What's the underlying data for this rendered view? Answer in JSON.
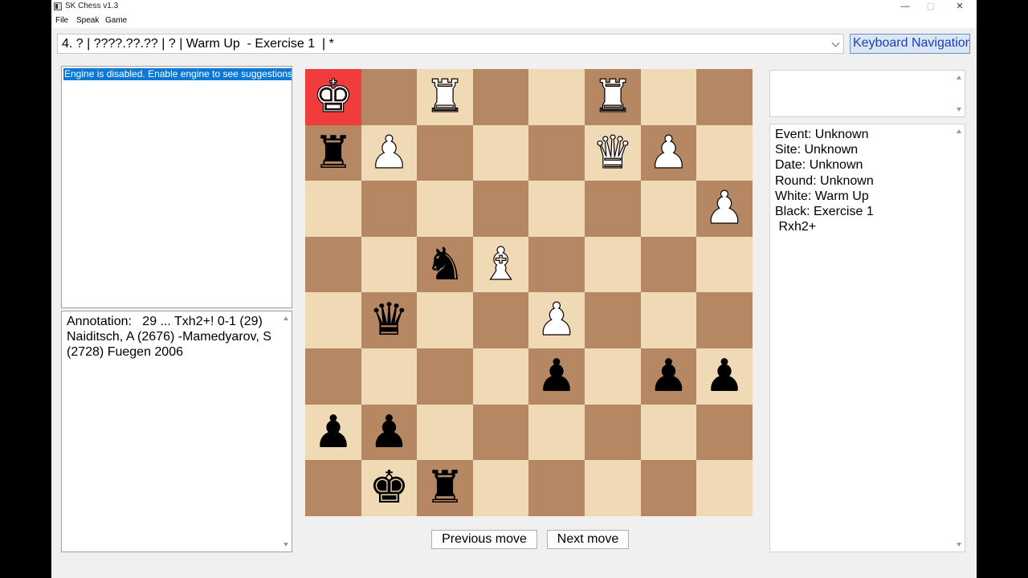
{
  "window": {
    "title": "SK Chess v1.3",
    "controls": {
      "minimize": "—",
      "maximize": "▢",
      "close": "✕"
    }
  },
  "menu": {
    "file": "File",
    "speak": "Speak",
    "game": "Game"
  },
  "game_select": {
    "value": "4. ? | ????.??.?? | ? | Warm Up  - Exercise 1  | *"
  },
  "keyboard_button": {
    "label": "Keyboard Navigation"
  },
  "engine": {
    "message": "Engine is disabled. Enable engine to see suggestions"
  },
  "annotation": {
    "text": "Annotation:   29 ... Txh2+! 0-1 (29) Naiditsch, A (2676) -Mamedyarov, S (2728) Fuegen 2006"
  },
  "board": {
    "colors": {
      "light": "#f0d9b5",
      "dark": "#b58863",
      "highlight": "#f03c3c"
    },
    "highlight_square": "a8",
    "pieces": [
      {
        "sq": "a8",
        "color": "white",
        "type": "king",
        "glyph": "♚"
      },
      {
        "sq": "c8",
        "color": "white",
        "type": "rook",
        "glyph": "♜"
      },
      {
        "sq": "f8",
        "color": "white",
        "type": "rook",
        "glyph": "♜"
      },
      {
        "sq": "a7",
        "color": "black",
        "type": "rook",
        "glyph": "♜"
      },
      {
        "sq": "b7",
        "color": "white",
        "type": "pawn",
        "glyph": "♟"
      },
      {
        "sq": "f7",
        "color": "white",
        "type": "queen",
        "glyph": "♛"
      },
      {
        "sq": "g7",
        "color": "white",
        "type": "pawn",
        "glyph": "♟"
      },
      {
        "sq": "h6",
        "color": "white",
        "type": "pawn",
        "glyph": "♟"
      },
      {
        "sq": "c5",
        "color": "black",
        "type": "knight",
        "glyph": "♞"
      },
      {
        "sq": "d5",
        "color": "white",
        "type": "bishop",
        "glyph": "♝"
      },
      {
        "sq": "b4",
        "color": "black",
        "type": "queen",
        "glyph": "♛"
      },
      {
        "sq": "e4",
        "color": "white",
        "type": "pawn",
        "glyph": "♟"
      },
      {
        "sq": "e3",
        "color": "black",
        "type": "pawn",
        "glyph": "♟"
      },
      {
        "sq": "g3",
        "color": "black",
        "type": "pawn",
        "glyph": "♟"
      },
      {
        "sq": "h3",
        "color": "black",
        "type": "pawn",
        "glyph": "♟"
      },
      {
        "sq": "a2",
        "color": "black",
        "type": "pawn",
        "glyph": "♟"
      },
      {
        "sq": "b2",
        "color": "black",
        "type": "pawn",
        "glyph": "♟"
      },
      {
        "sq": "b1",
        "color": "black",
        "type": "king",
        "glyph": "♚"
      },
      {
        "sq": "c1",
        "color": "black",
        "type": "rook",
        "glyph": "♜"
      }
    ]
  },
  "nav": {
    "previous": "Previous move",
    "next": "Next move"
  },
  "pgn": {
    "lines": [
      "Event: Unknown",
      "Site: Unknown",
      "Date: Unknown",
      "Round: Unknown",
      "White: Warm Up",
      "Black: Exercise 1",
      " Rxh2+"
    ]
  }
}
